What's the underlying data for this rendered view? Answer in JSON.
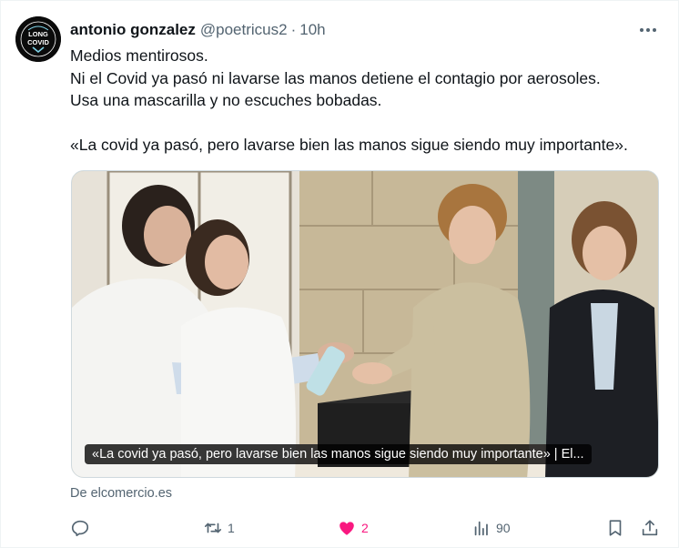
{
  "tweet": {
    "author_name": "antonio gonzalez",
    "handle": "@poetricus2",
    "separator": "·",
    "time": "10h",
    "avatar_label": "LONG COVID",
    "lines": [
      "Medios mentirosos.",
      "Ni el Covid ya pasó ni lavarse las manos detiene el contagio por aerosoles.",
      "Usa una mascarilla y no escuches bobadas.",
      "",
      "«La covid ya pasó, pero lavarse bien las manos sigue siendo muy importante»."
    ]
  },
  "card": {
    "caption": "«La covid ya pasó, pero lavarse bien las manos sigue siendo muy importante» | El...",
    "source": "De elcomercio.es"
  },
  "actions": {
    "reply": {
      "icon": "reply-icon",
      "count": ""
    },
    "retweet": {
      "icon": "retweet-icon",
      "count": "1"
    },
    "like": {
      "icon": "heart-icon",
      "count": "2",
      "color": "#f91880",
      "liked": true
    },
    "views": {
      "icon": "views-icon",
      "count": "90"
    },
    "bookmark": {
      "icon": "bookmark-icon"
    },
    "share": {
      "icon": "share-icon"
    }
  },
  "colors": {
    "text": "#0f1419",
    "secondary": "#536471",
    "like": "#f91880",
    "border": "#cfd9de"
  }
}
